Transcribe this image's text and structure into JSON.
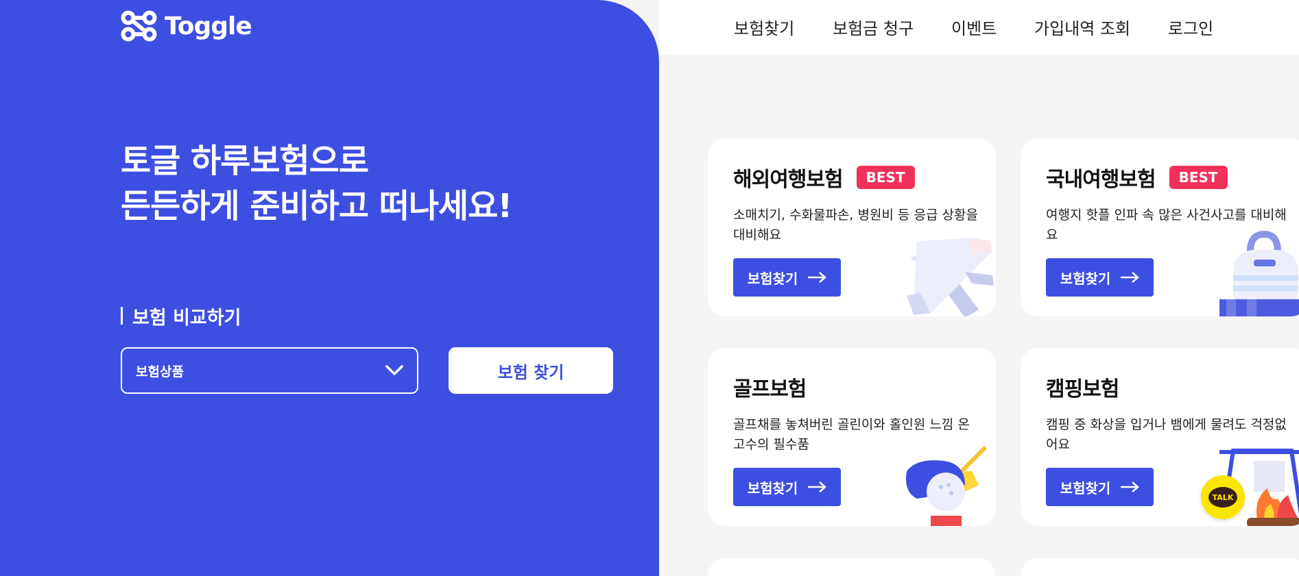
{
  "brand": {
    "name": "Toggle",
    "accent": "#3d4fe0",
    "best_color": "#f0325a"
  },
  "nav": {
    "items": [
      "보험찾기",
      "보험금 청구",
      "이벤트",
      "가입내역 조회",
      "로그인"
    ]
  },
  "hero": {
    "headline_line1": "토글 하루보험으로",
    "headline_line2": "든든하게 준비하고 떠나세요!",
    "compare_label": "보험 비교하기",
    "select_value": "보험상품",
    "find_button": "보험 찾기"
  },
  "cards": [
    {
      "title": "해외여행보험",
      "badge": "BEST",
      "desc": "소매치기, 수화물파손, 병원비 등 응급 상황을 대비해요",
      "button": "보험찾기",
      "icon": "airplane-icon"
    },
    {
      "title": "국내여행보험",
      "badge": "BEST",
      "desc": "여행지 핫플 인파 속 많은 사건사고를 대비해요",
      "button": "보험찾기",
      "icon": "backpack-icon"
    },
    {
      "title": "골프보험",
      "badge": "",
      "desc": "골프채를 놓쳐버린 골린이와 홀인원 느낌 온 고수의 필수품",
      "button": "보험찾기",
      "icon": "golf-icon"
    },
    {
      "title": "캠핑보험",
      "badge": "",
      "desc": "캠핑 중 화상을 입거나 뱀에게 물려도 걱정없어요",
      "button": "보험찾기",
      "icon": "campfire-icon"
    }
  ],
  "kakao": {
    "label": "TALK",
    "icon": "kakao-talk-icon"
  }
}
